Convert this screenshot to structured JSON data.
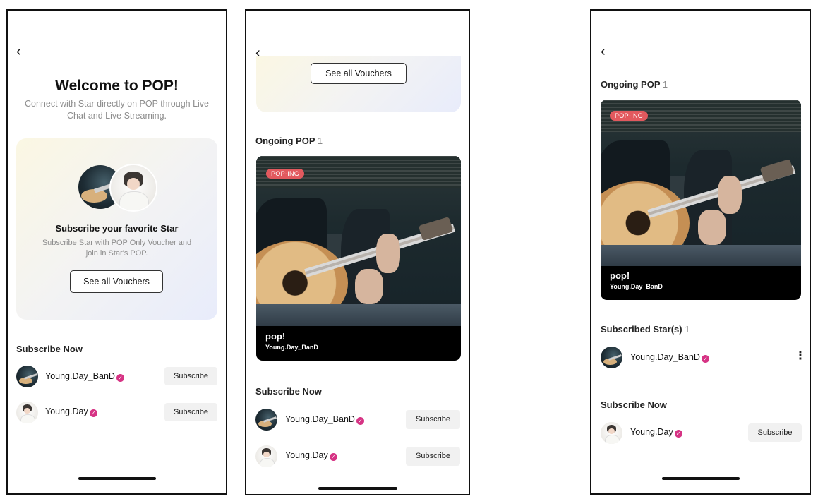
{
  "screen1": {
    "back_icon": "‹",
    "title": "Welcome to POP!",
    "subtitle": "Connect with Star directly on POP through Live Chat and Live Streaming.",
    "promo": {
      "title": "Subscribe your favorite Star",
      "description": "Subscribe Star with POP Only Voucher and join in Star's POP.",
      "button": "See all Vouchers"
    },
    "subscribe_now": {
      "title": "Subscribe Now",
      "rows": [
        {
          "name": "Young.Day_BanD",
          "button": "Subscribe"
        },
        {
          "name": "Young.Day",
          "button": "Subscribe"
        }
      ]
    }
  },
  "screen2": {
    "back_icon": "‹",
    "vouchers_button": "See all Vouchers",
    "ongoing": {
      "title": "Ongoing POP",
      "count": "1"
    },
    "card": {
      "badge": "POP-ING",
      "title": "pop!",
      "artist": "Young.Day_BanD"
    },
    "subscribe_now": {
      "title": "Subscribe Now",
      "rows": [
        {
          "name": "Young.Day_BanD",
          "button": "Subscribe"
        },
        {
          "name": "Young.Day",
          "button": "Subscribe"
        }
      ]
    }
  },
  "screen3": {
    "back_icon": "‹",
    "ongoing": {
      "title": "Ongoing POP",
      "count": "1"
    },
    "card": {
      "badge": "POP-ING",
      "title": "pop!",
      "artist": "Young.Day_BanD"
    },
    "subscribed": {
      "title": "Subscribed Star(s)",
      "count": "1",
      "rows": [
        {
          "name": "Young.Day_BanD",
          "more_icon": "⋮"
        }
      ]
    },
    "subscribe_now": {
      "title": "Subscribe Now",
      "rows": [
        {
          "name": "Young.Day",
          "button": "Subscribe"
        }
      ]
    }
  },
  "colors": {
    "verified": "#d63384",
    "badge": "#e2595e",
    "subscribe_bg": "#f1f1f1"
  },
  "icons": {
    "back": "chevron-left-icon",
    "verified": "verified-check-icon",
    "more": "more-vertical-icon"
  }
}
